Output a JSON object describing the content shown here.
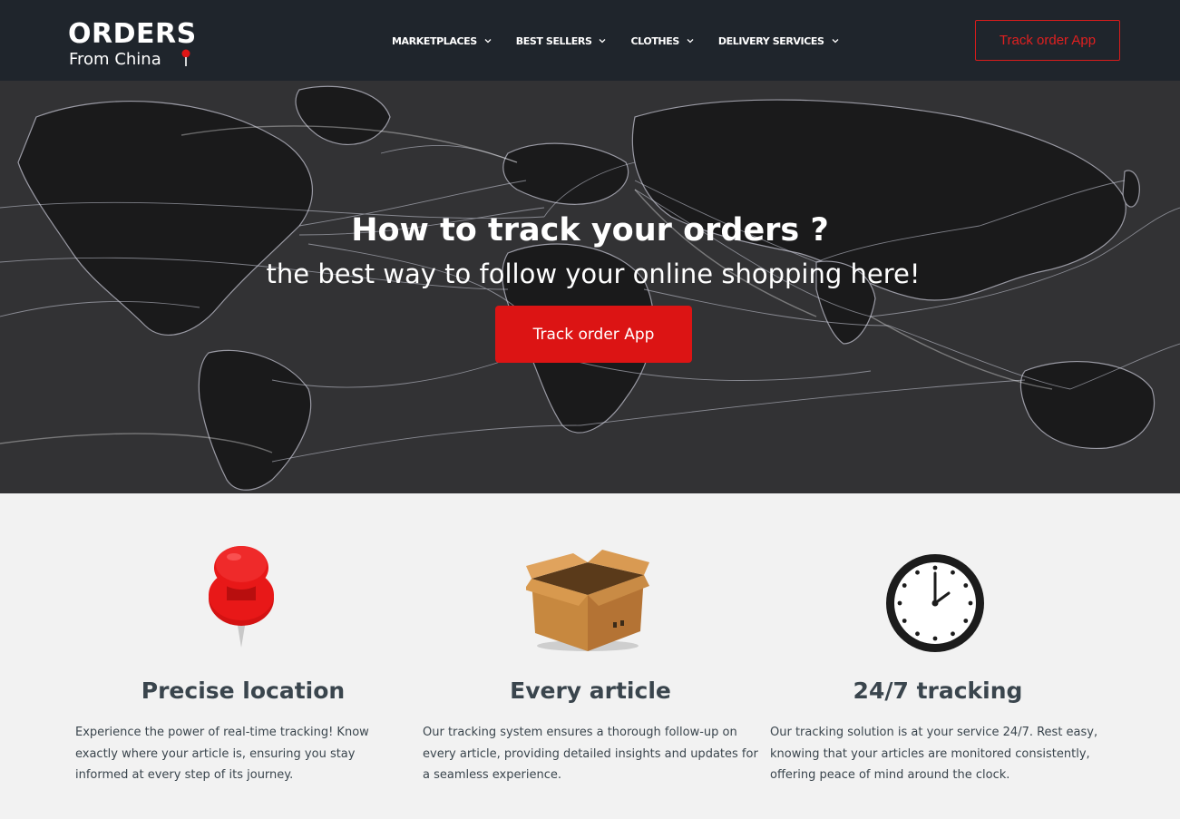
{
  "header": {
    "logo_top": "ORDERS",
    "logo_bottom": "From China",
    "nav": [
      {
        "label": "MARKETPLACES"
      },
      {
        "label": "BEST SELLERS"
      },
      {
        "label": "CLOTHES"
      },
      {
        "label": "DELIVERY SERVICES"
      }
    ],
    "cta_label": "Track order App"
  },
  "hero": {
    "title": "How to track your orders ?",
    "subtitle": "the best way to follow your online shopping here!",
    "button_label": "Track order App"
  },
  "features": [
    {
      "icon": "pushpin-icon",
      "title": "Precise location",
      "text": "Experience the power of real-time tracking! Know exactly where your article is, ensuring you stay informed at every step of its journey."
    },
    {
      "icon": "box-icon",
      "title": "Every article",
      "text": "Our tracking system ensures a thorough follow-up on every article, providing detailed insights and updates for a seamless experience."
    },
    {
      "icon": "clock-icon",
      "title": "24/7 tracking",
      "text": "Our tracking solution is at your service 24/7. Rest easy, knowing that your articles are monitored consistently, offering peace of mind around the clock."
    }
  ],
  "colors": {
    "header_bg": "#1f252c",
    "accent_red": "#dc1414",
    "text_dark": "#3a454d",
    "page_bg": "#f2f2f2"
  }
}
